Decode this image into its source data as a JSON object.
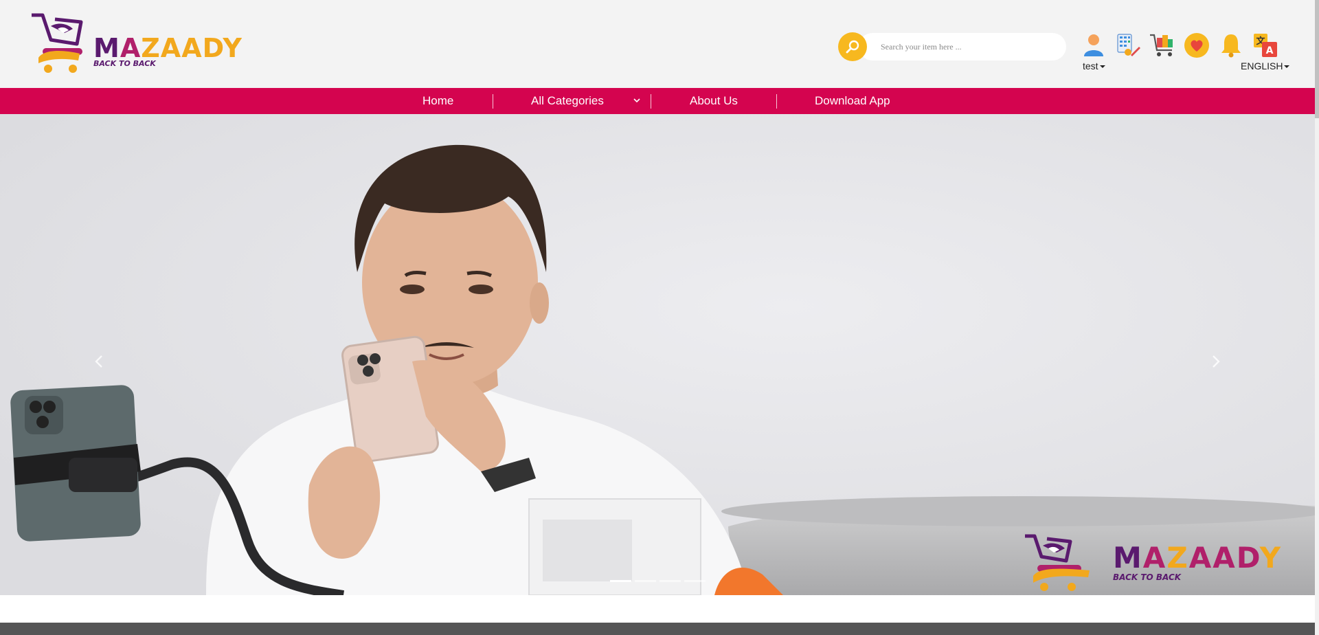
{
  "brand": {
    "name_part1": "M",
    "name_part2": "A",
    "name_part3": "ZAADY",
    "tagline": "BACK TO BACK"
  },
  "search": {
    "placeholder": "Search your item here ..."
  },
  "header": {
    "user_label": "test",
    "language_label": "ENGLISH",
    "icons": [
      "user-icon",
      "calculator-icon",
      "cart-icon",
      "favorite-heart-icon",
      "notification-bell-icon",
      "translate-icon"
    ]
  },
  "nav": {
    "items": [
      {
        "label": "Home"
      },
      {
        "label": "All Categories"
      },
      {
        "label": "About Us"
      },
      {
        "label": "Download App"
      }
    ]
  },
  "hero": {
    "slide_count": 4,
    "active_slide": 1,
    "overlay_brand": {
      "name": "MAZAADY",
      "tagline": "BACK TO BACK"
    }
  },
  "colors": {
    "navbar": "#d4044f",
    "search_button": "#f7b81f",
    "brand_purple": "#5a1a6e",
    "brand_magenta": "#b0206a",
    "brand_gold": "#f2a81d"
  }
}
